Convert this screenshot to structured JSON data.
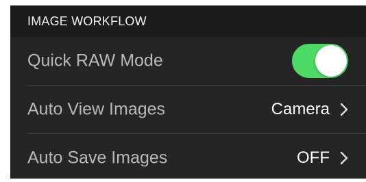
{
  "section": {
    "title": "IMAGE WORKFLOW"
  },
  "rows": [
    {
      "label": "Quick RAW Mode",
      "control": "toggle",
      "toggle_on": true,
      "toggle_color": "#4cd964"
    },
    {
      "label": "Auto View Images",
      "value": "Camera",
      "icon": "chevron-right-icon"
    },
    {
      "label": "Auto Save Images",
      "value": "OFF",
      "icon": "chevron-right-icon"
    }
  ],
  "colors": {
    "panel_background": "#252525",
    "header_background": "#1b1b1b",
    "label_text": "#b8b8b8",
    "value_text": "#ffffff",
    "divider": "#4a4a4a"
  }
}
